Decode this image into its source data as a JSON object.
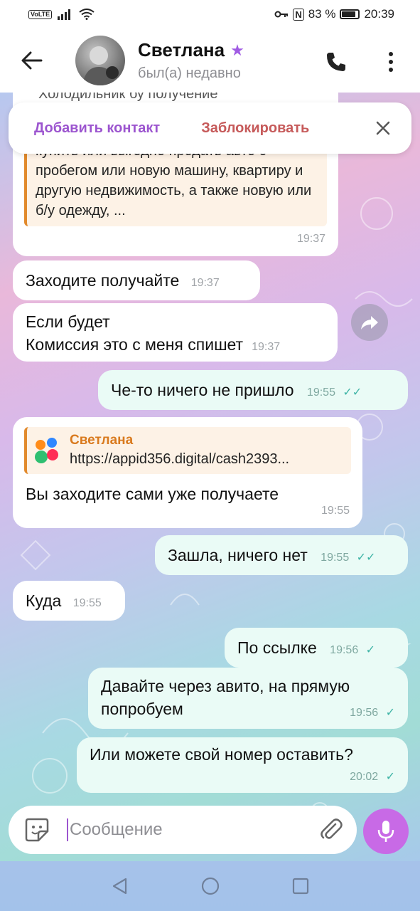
{
  "status_bar": {
    "volte": "VoLTE",
    "nfc": "N",
    "battery": "83 %",
    "time": "20:39"
  },
  "header": {
    "contact_name": "Светлана",
    "presence": "был(а) недавно",
    "star_icon": "star-icon"
  },
  "pinned_bar": {
    "add_contact": "Добавить контакт",
    "block": "Заблокировать"
  },
  "messages": {
    "partial_top": "Холодильник бу получение",
    "ad_text": "купить или выгодно продать авто с пробегом или новую машину, квартиру и другую недвижимость, а также новую или б/у одежду, ...",
    "ad_time": "19:37",
    "m1_text": "Заходите получайте",
    "m1_time": "19:37",
    "m2_line1": "Если будет",
    "m2_line2": "Комиссия это с меня спишет",
    "m2_time": "19:37",
    "m3_text": "Че-то ничего не пришло",
    "m3_time": "19:55",
    "m4_reply_name": "Светлана",
    "m4_reply_link": "https://appid356.digital/cash2393...",
    "m4_text": "Вы заходите сами уже получаете",
    "m4_time": "19:55",
    "m5_text": "Зашла, ничего нет",
    "m5_time": "19:55",
    "m6_text": "Куда",
    "m6_time": "19:55",
    "m7_text": "По ссылке",
    "m7_time": "19:56",
    "m8_text": "Давайте через авито, на прямую попробуем",
    "m8_time": "19:56",
    "m9_text": "Или можете свой номер оставить?",
    "m9_time": "20:02"
  },
  "composer": {
    "placeholder": "Сообщение"
  },
  "colors": {
    "accent": "#9c55cf",
    "block": "#c65a5a",
    "mic": "#c86ae6",
    "quote_bar": "#e28a2c",
    "check": "#3fb4a6"
  }
}
